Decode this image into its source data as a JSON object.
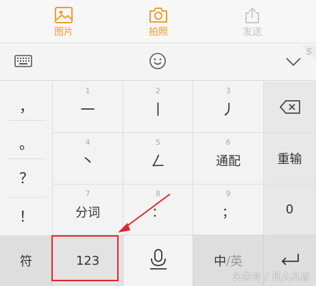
{
  "action_bar": {
    "items": [
      {
        "label": "图片",
        "icon": "image-icon",
        "color": "#f39a2b"
      },
      {
        "label": "拍照",
        "icon": "camera-icon",
        "color": "#f39a2b"
      },
      {
        "label": "发送",
        "icon": "share-upload-icon",
        "color": "#c4c4c4"
      }
    ]
  },
  "toolbar": {
    "icons": [
      "keyboard-icon",
      "emoji-icon",
      "chevron-down-icon"
    ]
  },
  "keyboard": {
    "punctuation": [
      "，",
      "。",
      "？",
      "！"
    ],
    "stroke_keys": [
      {
        "num": "1",
        "glyph": "一"
      },
      {
        "num": "2",
        "glyph": "丨"
      },
      {
        "num": "3",
        "glyph": "丿"
      },
      {
        "num": "4",
        "glyph": "丶"
      },
      {
        "num": "5",
        "glyph": "ㄥ"
      },
      {
        "num": "6",
        "glyph": "通配"
      },
      {
        "num": "7",
        "glyph": "分词"
      },
      {
        "num": "8",
        "glyph": "："
      },
      {
        "num": "9",
        "glyph": "；"
      }
    ],
    "right_column": {
      "backspace_icon": "backspace-icon",
      "reinput": "重输",
      "zero": "0"
    },
    "bottom_row": {
      "symbols": "符",
      "numbers": "123",
      "mic_icon": "microphone-icon",
      "lang_active": "中",
      "lang_sep": "/",
      "lang_inactive": "英",
      "enter_icon": "enter-icon"
    }
  },
  "annotation": {
    "highlight_color": "#e0262b"
  },
  "watermark": "头条号 / 凡人凡言"
}
